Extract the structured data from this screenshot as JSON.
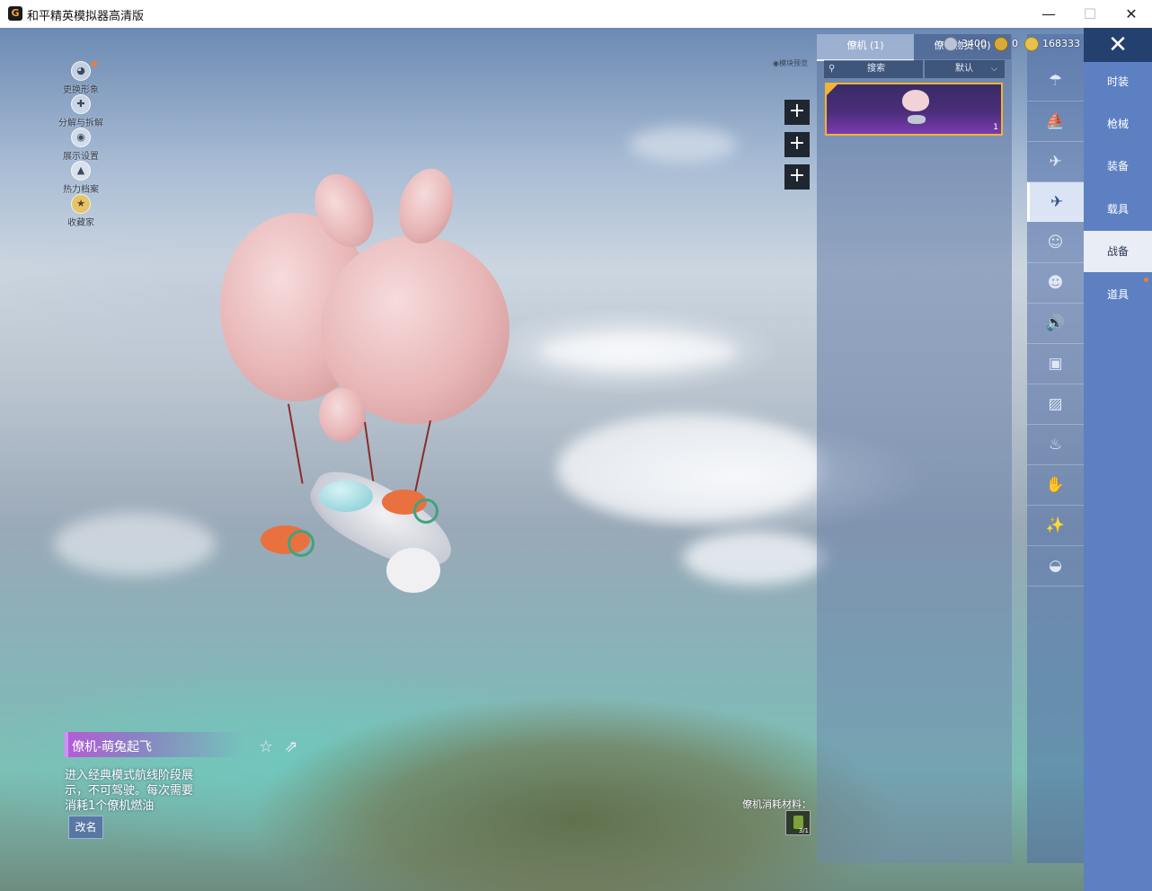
{
  "window": {
    "title": "和平精英模拟器高清版",
    "icon_letter": "G",
    "minimize": "—",
    "maximize": "☐",
    "close": "✕"
  },
  "currency": [
    {
      "value": "3400",
      "icon": "moon-coin-icon",
      "color": "#b9c2d6"
    },
    {
      "value": "0",
      "icon": "gold-badge-icon",
      "color": "#d9a93a"
    },
    {
      "value": "168333",
      "icon": "coupon-coin-icon",
      "color": "#e6c24d"
    }
  ],
  "left_menu": [
    {
      "label": "更换形象",
      "icon": "avatar-icon",
      "glyph": "◕",
      "notify": true
    },
    {
      "label": "分解与拆解",
      "icon": "decompose-icon",
      "glyph": "✚"
    },
    {
      "label": "展示设置",
      "icon": "eye-icon",
      "glyph": "◉"
    },
    {
      "label": "热力档案",
      "icon": "flame-icon",
      "glyph": "▲"
    },
    {
      "label": "收藏家",
      "icon": "collector-badge-icon",
      "glyph": "★"
    }
  ],
  "preview": {
    "label": "◉模块预览",
    "slot_glyph": "+"
  },
  "tabs": [
    {
      "label": "僚机 (1)"
    },
    {
      "label": "僚机物资 (0)"
    }
  ],
  "search": {
    "icon": "search-icon",
    "glyph": "⚲",
    "placeholder": "搜索"
  },
  "sort": {
    "selected": "默认",
    "chevron": "⌵"
  },
  "item_card": {
    "count": "1",
    "selected": true
  },
  "icon_column": [
    {
      "icon": "parachute-icon",
      "glyph": "☂"
    },
    {
      "icon": "boat-icon",
      "glyph": "⛵"
    },
    {
      "icon": "drone-icon",
      "glyph": "✈"
    },
    {
      "icon": "plane-icon",
      "glyph": "✈",
      "active": true
    },
    {
      "icon": "emote-face-icon",
      "glyph": "☺"
    },
    {
      "icon": "robot-icon",
      "glyph": "☻"
    },
    {
      "icon": "speaker-icon",
      "glyph": "🔊"
    },
    {
      "icon": "mailbox-icon",
      "glyph": "▣"
    },
    {
      "icon": "picture-icon",
      "glyph": "▨"
    },
    {
      "icon": "extinguisher-icon",
      "glyph": "♨"
    },
    {
      "icon": "hand-icon",
      "glyph": "✋"
    },
    {
      "icon": "sparkle-wand-icon",
      "glyph": "✨"
    },
    {
      "icon": "ufo-icon",
      "glyph": "◒"
    }
  ],
  "categories": [
    {
      "label": "时装"
    },
    {
      "label": "枪械"
    },
    {
      "label": "装备"
    },
    {
      "label": "载具"
    },
    {
      "label": "战备",
      "active": true
    },
    {
      "label": "道具"
    }
  ],
  "item": {
    "name": "僚机-萌兔起飞",
    "description": "进入经典模式航线阶段展示，不可驾驶。每次需要消耗1个僚机燃油",
    "rename_label": "改名",
    "favorite_icon": "☆",
    "share_icon": "⇗"
  },
  "consume": {
    "label": "僚机消耗材料：",
    "count": "3/1"
  },
  "colors": {
    "accent_blue": "#5d80c2",
    "card_border": "#f2b335",
    "name_bar": "#b45bd6"
  }
}
